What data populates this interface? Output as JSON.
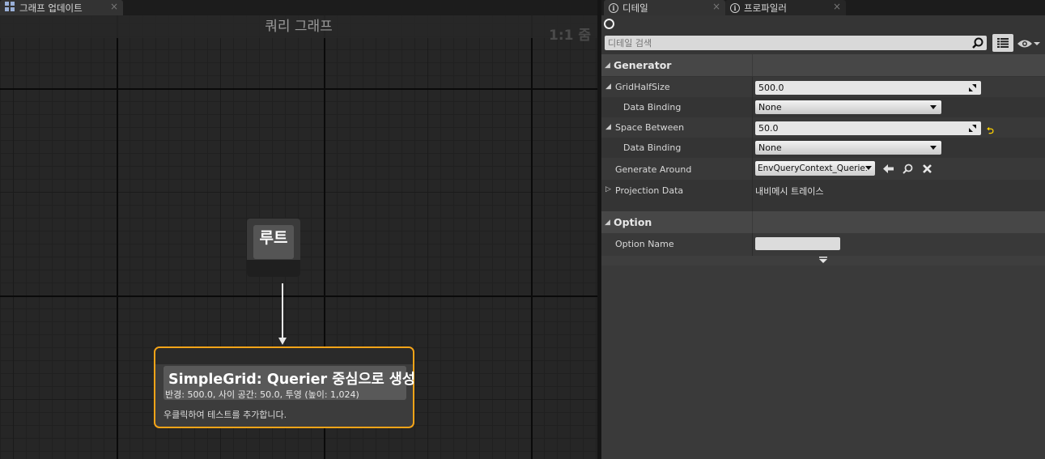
{
  "graph_panel": {
    "tab_label": "그래프 업데이트",
    "title": "쿼리 그래프",
    "zoom": "1:1 줌",
    "root_node": {
      "title": "루트"
    },
    "generator_node": {
      "title": "SimpleGrid: Querier 중심으로 생성",
      "subtitle": "반경: 500.0, 사이 공간: 50.0, 투영 (높이: 1,024)",
      "hint": "우클릭하여 테스트를 추가합니다."
    }
  },
  "details_panel": {
    "tabs": [
      {
        "label": "디테일"
      },
      {
        "label": "프로파일러"
      }
    ],
    "search": {
      "placeholder": "디테일 검색"
    },
    "categories": [
      {
        "label": "Generator"
      },
      {
        "label": "Option"
      }
    ],
    "properties": {
      "grid_half_size": {
        "label": "GridHalfSize",
        "value": "500.0"
      },
      "grid_half_size_binding": {
        "label": "Data Binding",
        "value": "None"
      },
      "space_between": {
        "label": "Space Between",
        "value": "50.0"
      },
      "space_between_binding": {
        "label": "Data Binding",
        "value": "None"
      },
      "generate_around": {
        "label": "Generate Around",
        "value": "EnvQueryContext_Querier"
      },
      "projection_data": {
        "label": "Projection Data",
        "value": "내비메시 트레이스"
      },
      "option_name": {
        "label": "Option Name",
        "value": ""
      }
    }
  },
  "colors": {
    "node_highlight": "#f5a418",
    "reset_arrow": "#ffd200"
  }
}
